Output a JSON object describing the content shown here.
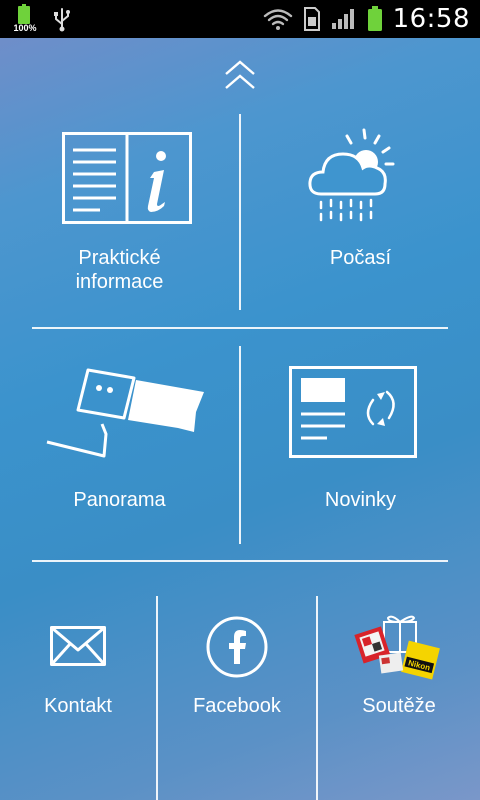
{
  "status_bar": {
    "battery_percent_label": "100%",
    "time": "16:58"
  },
  "menu": {
    "collapse_icon": "double-chevron-up-icon",
    "tiles": [
      {
        "id": "prakticke-informace",
        "label": "Praktické\ninformace",
        "icon": "info-book-icon"
      },
      {
        "id": "pocasi",
        "label": "Počasí",
        "icon": "weather-cloud-sun-rain-icon"
      },
      {
        "id": "panorama",
        "label": "Panorama",
        "icon": "security-camera-icon"
      },
      {
        "id": "novinky",
        "label": "Novinky",
        "icon": "news-refresh-icon"
      },
      {
        "id": "kontakt",
        "label": "Kontakt",
        "icon": "envelope-icon"
      },
      {
        "id": "facebook",
        "label": "Facebook",
        "icon": "facebook-icon"
      },
      {
        "id": "soutěže",
        "label": "Soutěže",
        "icon": "gifts-prizes-icon"
      }
    ]
  },
  "colors": {
    "status_bar_bg": "#000000",
    "battery_green": "#6fd23b",
    "menu_bg_top": "#6f8ec9",
    "menu_bg_mid": "#3b93cd",
    "text": "#ffffff"
  }
}
